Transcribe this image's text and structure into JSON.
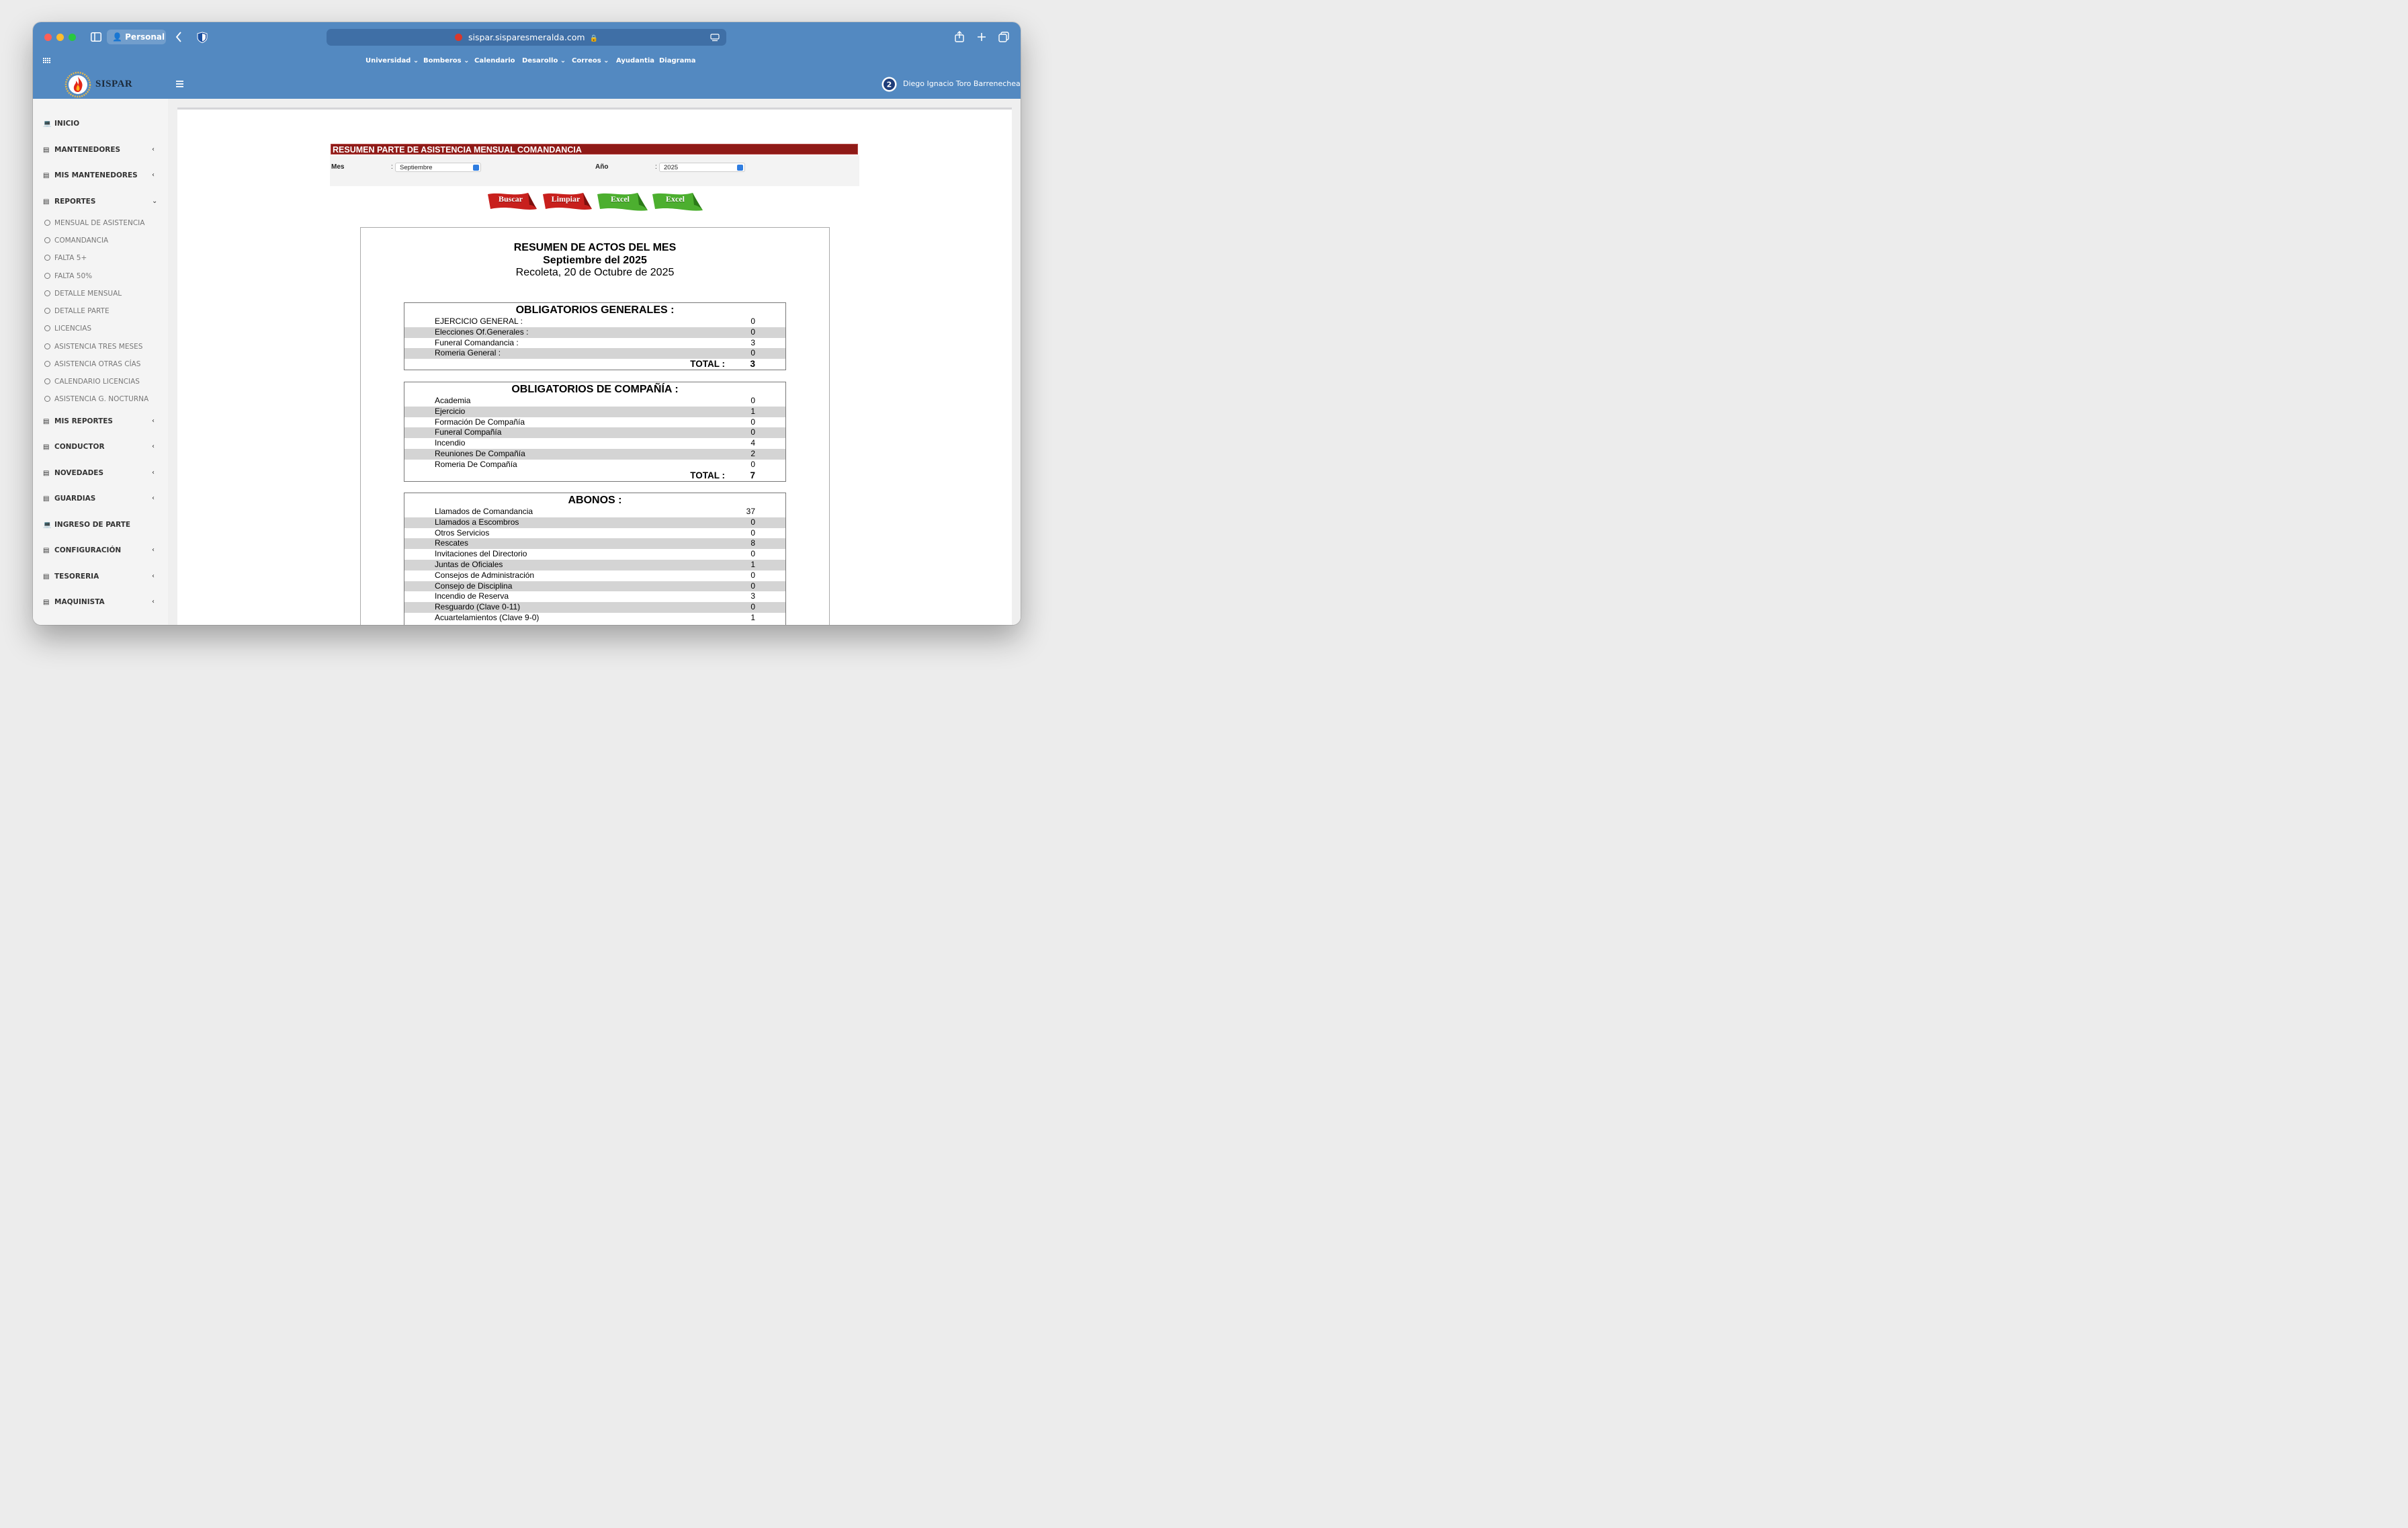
{
  "browser": {
    "profile": "Personal",
    "url": "sispar.sisparesmeralda.com"
  },
  "navbar": {
    "items": [
      {
        "label": "Universidad",
        "dropdown": true
      },
      {
        "label": "Bomberos",
        "dropdown": true
      },
      {
        "label": "Calendario",
        "dropdown": false
      },
      {
        "label": "Desarollo",
        "dropdown": true
      },
      {
        "label": "Correos",
        "dropdown": true
      },
      {
        "label": "Ayudantia",
        "dropdown": false
      },
      {
        "label": "Diagrama",
        "dropdown": false
      }
    ]
  },
  "header": {
    "logo_text": "SISPAR",
    "user_name": "Diego Ignacio Toro Barrenechea"
  },
  "sidebar": {
    "items": [
      {
        "label": "INICIO",
        "icon": "laptop-icon",
        "has_children": false
      },
      {
        "label": "MANTENEDORES",
        "icon": "table-icon",
        "has_children": true
      },
      {
        "label": "MIS MANTENEDORES",
        "icon": "table-icon",
        "has_children": true
      },
      {
        "label": "REPORTES",
        "icon": "table-icon",
        "has_children": true,
        "expanded": true
      },
      {
        "label": "MIS REPORTES",
        "icon": "table-icon",
        "has_children": true
      },
      {
        "label": "CONDUCTOR",
        "icon": "table-icon",
        "has_children": true
      },
      {
        "label": "NOVEDADES",
        "icon": "table-icon",
        "has_children": true
      },
      {
        "label": "GUARDIAS",
        "icon": "table-icon",
        "has_children": true
      },
      {
        "label": "INGRESO DE PARTE",
        "icon": "laptop-icon",
        "has_children": false
      },
      {
        "label": "CONFIGURACIÓN",
        "icon": "table-icon",
        "has_children": true
      },
      {
        "label": "TESORERIA",
        "icon": "table-icon",
        "has_children": true
      },
      {
        "label": "MAQUINISTA",
        "icon": "table-icon",
        "has_children": true
      }
    ],
    "reportes_sub": [
      "MENSUAL DE ASISTENCIA",
      "COMANDANCIA",
      "FALTA 5+",
      "FALTA 50%",
      "DETALLE MENSUAL",
      "DETALLE PARTE",
      "LICENCIAS",
      "ASISTENCIA TRES MESES",
      "ASISTENCIA OTRAS CÍAS",
      "CALENDARIO LICENCIAS",
      "ASISTENCIA G. NOCTURNA"
    ]
  },
  "form": {
    "banner": "RESUMEN PARTE DE ASISTENCIA MENSUAL COMANDANCIA",
    "mes_label": "Mes",
    "mes_value": "Septiembre",
    "anio_label": "Año",
    "anio_value": "2025",
    "colon": ":",
    "buttons": [
      {
        "label": "Buscar",
        "color": "#c8201d"
      },
      {
        "label": "Limpiar",
        "color": "#c8201d"
      },
      {
        "label": "Excel",
        "color": "#4caf2f"
      },
      {
        "label": "Excel",
        "color": "#4caf2f"
      }
    ]
  },
  "report": {
    "title": "RESUMEN DE ACTOS DEL MES",
    "subtitle": "Septiembre del 2025",
    "place_date": "Recoleta, 20 de Octubre de 2025",
    "total_label": "TOTAL :",
    "sections": [
      {
        "heading": "OBLIGATORIOS GENERALES :",
        "rows": [
          {
            "label": "EJERCICIO GENERAL :",
            "value": "0"
          },
          {
            "label": "Elecciones Of.Generales :",
            "value": "0"
          },
          {
            "label": "Funeral Comandancia :",
            "value": "3"
          },
          {
            "label": "Romeria General :",
            "value": "0"
          }
        ],
        "total": "3"
      },
      {
        "heading": "OBLIGATORIOS DE COMPAÑÍA :",
        "rows": [
          {
            "label": "Academia",
            "value": "0"
          },
          {
            "label": "Ejercicio",
            "value": "1"
          },
          {
            "label": "Formación De Compañía",
            "value": "0"
          },
          {
            "label": "Funeral Compañía",
            "value": "0"
          },
          {
            "label": "Incendio",
            "value": "4"
          },
          {
            "label": "Reuniones De Compañía",
            "value": "2"
          },
          {
            "label": "Romeria De Compañía",
            "value": "0"
          }
        ],
        "total": "7"
      },
      {
        "heading": "ABONOS :",
        "rows": [
          {
            "label": "Llamados de Comandancia",
            "value": "37"
          },
          {
            "label": "Llamados a Escombros",
            "value": "0"
          },
          {
            "label": "Otros Servicios",
            "value": "0"
          },
          {
            "label": "Rescates",
            "value": "8"
          },
          {
            "label": "Invitaciones del Directorio",
            "value": "0"
          },
          {
            "label": "Juntas de Oficiales",
            "value": "1"
          },
          {
            "label": "Consejos de Administración",
            "value": "0"
          },
          {
            "label": "Consejo de Disciplina",
            "value": "0"
          },
          {
            "label": "Incendio de Reserva",
            "value": "3"
          },
          {
            "label": "Resguardo (Clave 0-11)",
            "value": "0"
          },
          {
            "label": "Acuartelamientos (Clave 9-0)",
            "value": "1"
          }
        ],
        "total": ""
      }
    ]
  },
  "colors": {
    "header_blue": "#5389c1",
    "banner_red": "#8f1a17",
    "row_alt": "#d4d4d4"
  }
}
